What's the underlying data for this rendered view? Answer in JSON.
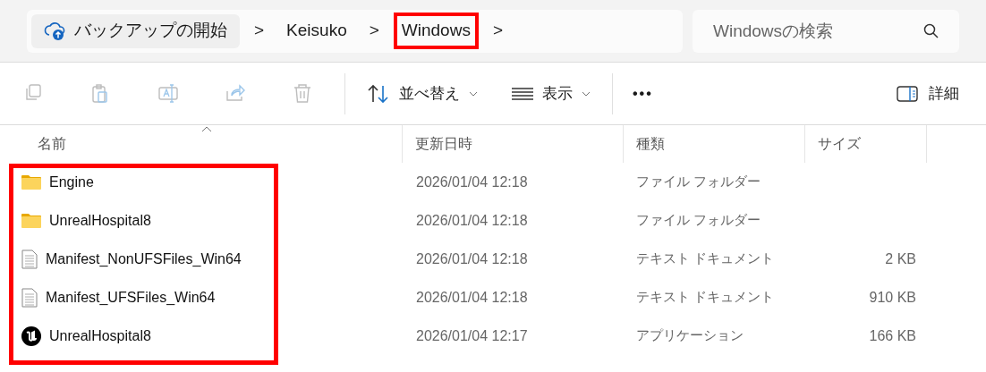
{
  "breadcrumb": {
    "root": "バックアップの開始",
    "items": [
      {
        "label": "Keisuko",
        "highlighted": false
      },
      {
        "label": "Windows",
        "highlighted": true
      }
    ],
    "separator": ">"
  },
  "search": {
    "placeholder": "Windowsの検索"
  },
  "toolbar": {
    "actions": [
      {
        "kind": "copy",
        "disabled": true
      },
      {
        "kind": "paste",
        "disabled": true
      },
      {
        "kind": "rename",
        "disabled": true
      },
      {
        "kind": "share",
        "disabled": true
      },
      {
        "kind": "delete",
        "disabled": true
      }
    ],
    "sort": "並べ替え",
    "view": "表示",
    "more": "•••",
    "details": "詳細"
  },
  "table": {
    "columns": [
      {
        "label": "名前",
        "sorted": true
      },
      {
        "label": "更新日時",
        "sorted": false
      },
      {
        "label": "種類",
        "sorted": false
      },
      {
        "label": "サイズ",
        "sorted": false
      }
    ],
    "rows_highlighted": true,
    "rows": [
      {
        "kind": "folder",
        "name": "Engine",
        "date": "2026/01/04 12:18",
        "type": "ファイル フォルダー"
      },
      {
        "kind": "folder",
        "name": "UnrealHospital8",
        "date": "2026/01/04 12:18",
        "type": "ファイル フォルダー"
      },
      {
        "kind": "text",
        "name": "Manifest_NonUFSFiles_Win64",
        "date": "2026/01/04 12:18",
        "type": "テキスト ドキュメント",
        "size": "2 KB"
      },
      {
        "kind": "text",
        "name": "Manifest_UFSFiles_Win64",
        "date": "2026/01/04 12:18",
        "type": "テキスト ドキュメント",
        "size": "910 KB"
      },
      {
        "kind": "app",
        "name": "UnrealHospital8",
        "date": "2026/01/04 12:17",
        "type": "アプリケーション",
        "size": "166 KB"
      }
    ]
  }
}
